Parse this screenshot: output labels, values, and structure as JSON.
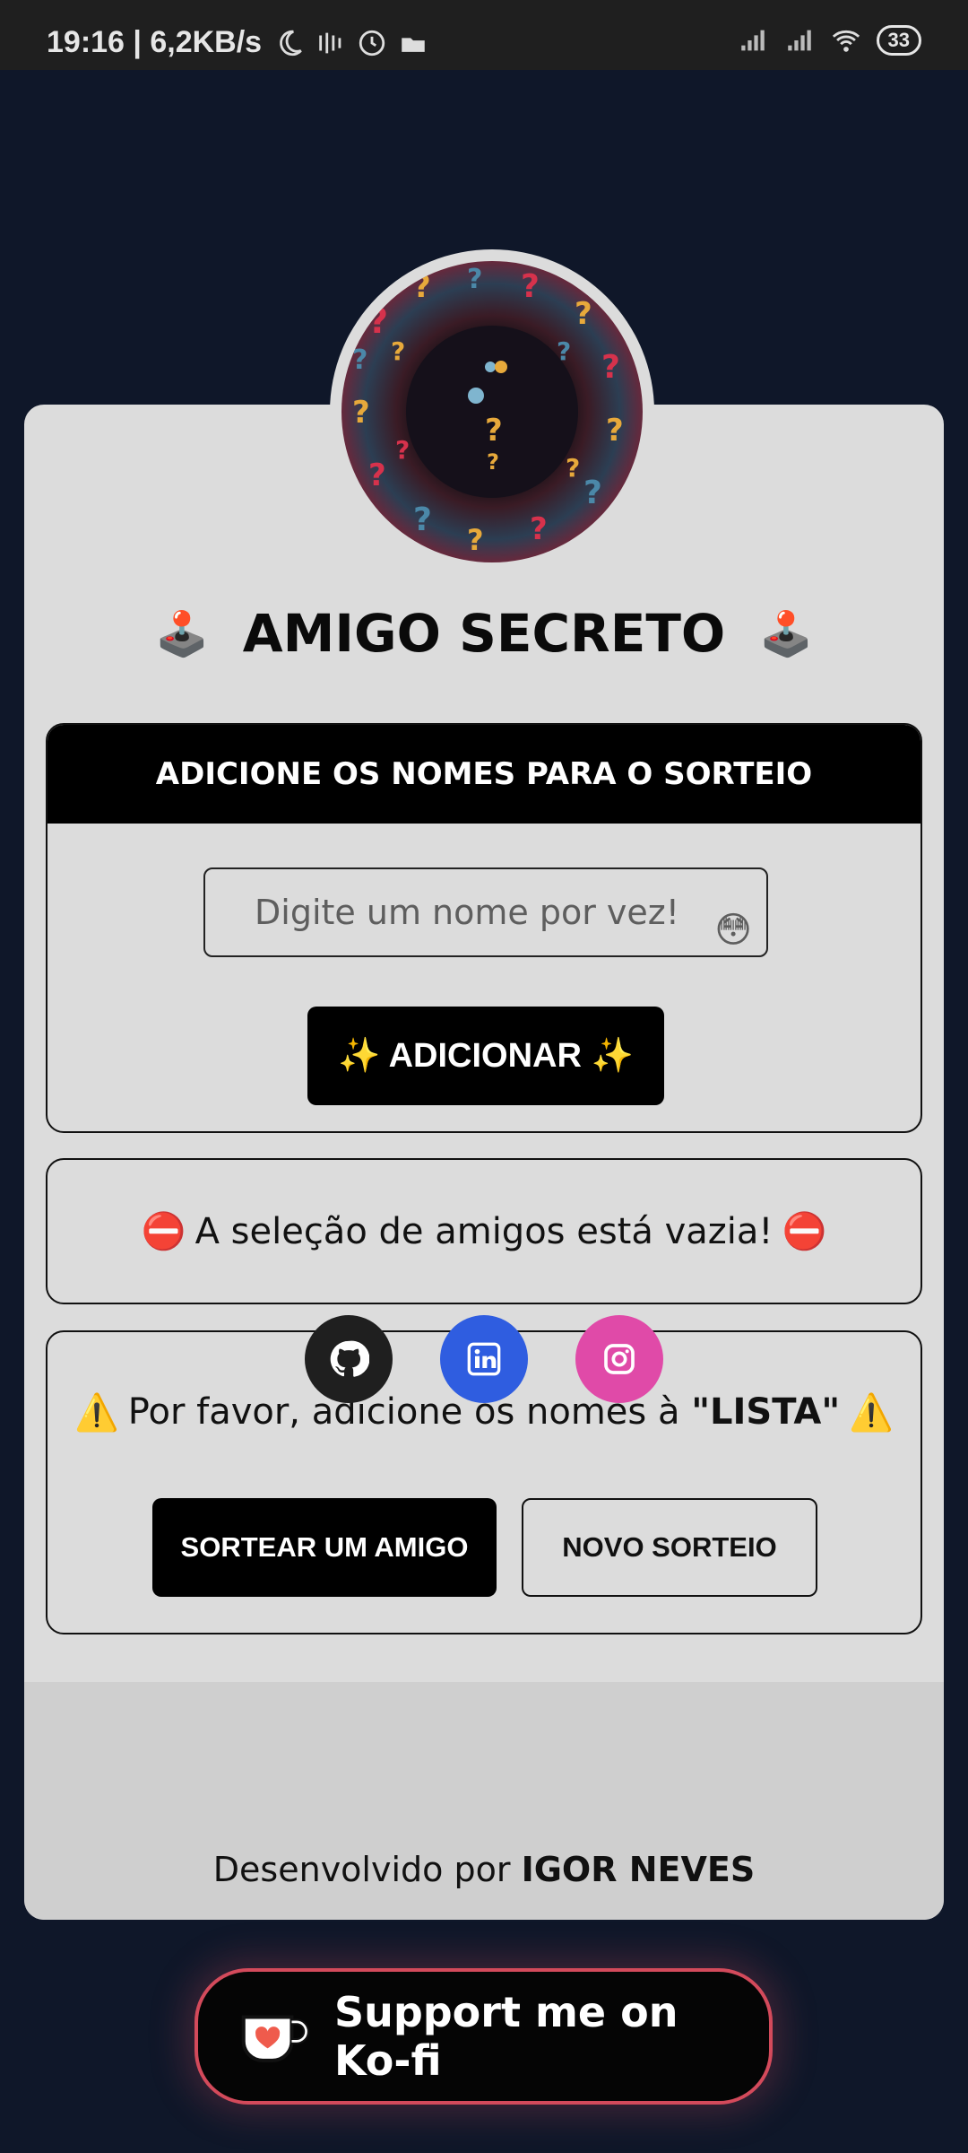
{
  "status_bar": {
    "time_and_speed": "19:16 | 6,2KB/s",
    "battery": "33"
  },
  "header": {
    "title": "AMIGO SECRETO",
    "left_emoji": "🕹️",
    "right_emoji": "🕹️"
  },
  "add_section": {
    "heading": "ADICIONE OS NOMES PARA O SORTEIO",
    "input_placeholder": "Digite um nome por vez!",
    "input_emoji": "😳",
    "add_button": "✨ ADICIONAR ✨"
  },
  "list_section": {
    "empty_message": "A seleção de amigos está vazia!",
    "icon": "⛔"
  },
  "draw_section": {
    "warning_prefix": "Por favor, adicione os nomes à ",
    "warning_emphasis": "\"LISTA\"",
    "warning_icon": "⚠️",
    "draw_button": "SORTEAR UM AMIGO",
    "new_draw_button": "NOVO SORTEIO"
  },
  "footer": {
    "social": [
      {
        "name": "github",
        "color": "#1f1f1f"
      },
      {
        "name": "linkedin",
        "color": "#2f5de0"
      },
      {
        "name": "instagram",
        "color": "#e04aa8"
      }
    ],
    "developed_by_label": "Desenvolvido por",
    "developer_name": "IGOR NEVES"
  },
  "kofi": {
    "label": "Support me on Ko-fi"
  }
}
